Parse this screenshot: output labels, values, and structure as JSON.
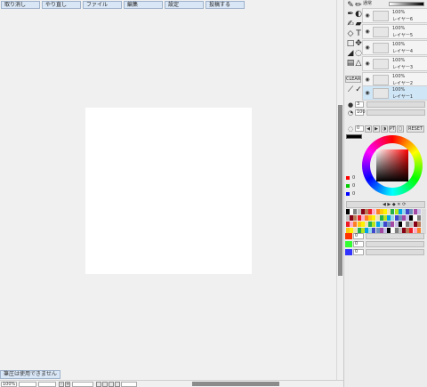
{
  "menu": {
    "undo": "取り消し",
    "redo": "やり直し",
    "file": "ファイル",
    "edit": "編集",
    "settings": "設定",
    "post": "投稿する"
  },
  "status": {
    "pressure_message": "筆圧は使用できません",
    "zoom": "100%"
  },
  "layers_panel": {
    "blend_mode": "通常",
    "layers": [
      {
        "opacity": "100%",
        "name": "レイヤー6"
      },
      {
        "opacity": "100%",
        "name": "レイヤー5"
      },
      {
        "opacity": "100%",
        "name": "レイヤー4"
      },
      {
        "opacity": "100%",
        "name": "レイヤー3"
      },
      {
        "opacity": "100%",
        "name": "レイヤー2"
      },
      {
        "opacity": "100%",
        "name": "レイヤー1"
      }
    ],
    "clear_label": "CLEAR"
  },
  "brush": {
    "size": "3",
    "opacity": "100",
    "density": "0",
    "reset_label": "RESET",
    "pt_label": "PT"
  },
  "color": {
    "r": "0",
    "g": "0",
    "b": "0",
    "slider_r": "0",
    "slider_g": "0",
    "slider_b": "0",
    "current": "#000000"
  },
  "palette": {
    "colors": [
      "#000000",
      "#ffffff",
      "#7f7f7f",
      "#c3c3c3",
      "#880015",
      "#b97a57",
      "#ed1c24",
      "#ffaec9",
      "#ff7f27",
      "#ffc90e",
      "#fff200",
      "#efe4b0",
      "#22b14c",
      "#b5e61d",
      "#00a2e8",
      "#99d9ea",
      "#3f48cc",
      "#7092be",
      "#a349a4",
      "#c8bfe7"
    ]
  },
  "icons": {
    "eye": "eye-icon",
    "pen": "pen-icon",
    "eraser": "eraser-icon",
    "bucket": "bucket-icon",
    "text": "text-icon",
    "eyedropper": "eyedropper-icon"
  }
}
